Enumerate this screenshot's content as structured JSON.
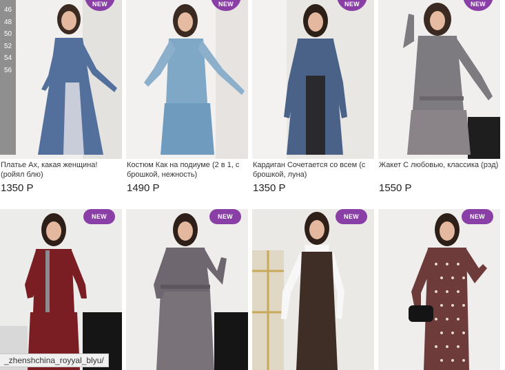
{
  "sizes": [
    "46",
    "48",
    "50",
    "52",
    "54",
    "56"
  ],
  "badge_label": "NEW",
  "products": [
    {
      "title": "Платье Ах, какая женщина! (ройял блю)",
      "price": "1350 Р"
    },
    {
      "title": "Костюм Как на подиуме (2 в 1, с брошкой, нежность)",
      "price": "1490 Р"
    },
    {
      "title": "Кардиган Сочетается со всем (с брошкой, луна)",
      "price": "1350 Р"
    },
    {
      "title": "Жакет С любовью, классика (рэд)",
      "price": "1550 Р"
    }
  ],
  "row2_products": [
    {
      "name": "burgundy-suit"
    },
    {
      "name": "plaid-suit"
    },
    {
      "name": "brown-vest-dress"
    },
    {
      "name": "polka-dot-dress"
    }
  ],
  "status_url": "_zhenshchina_royyal_blyu/",
  "colors": {
    "badge": "#8a3fa6",
    "size_strip": "#8f8f8f"
  }
}
